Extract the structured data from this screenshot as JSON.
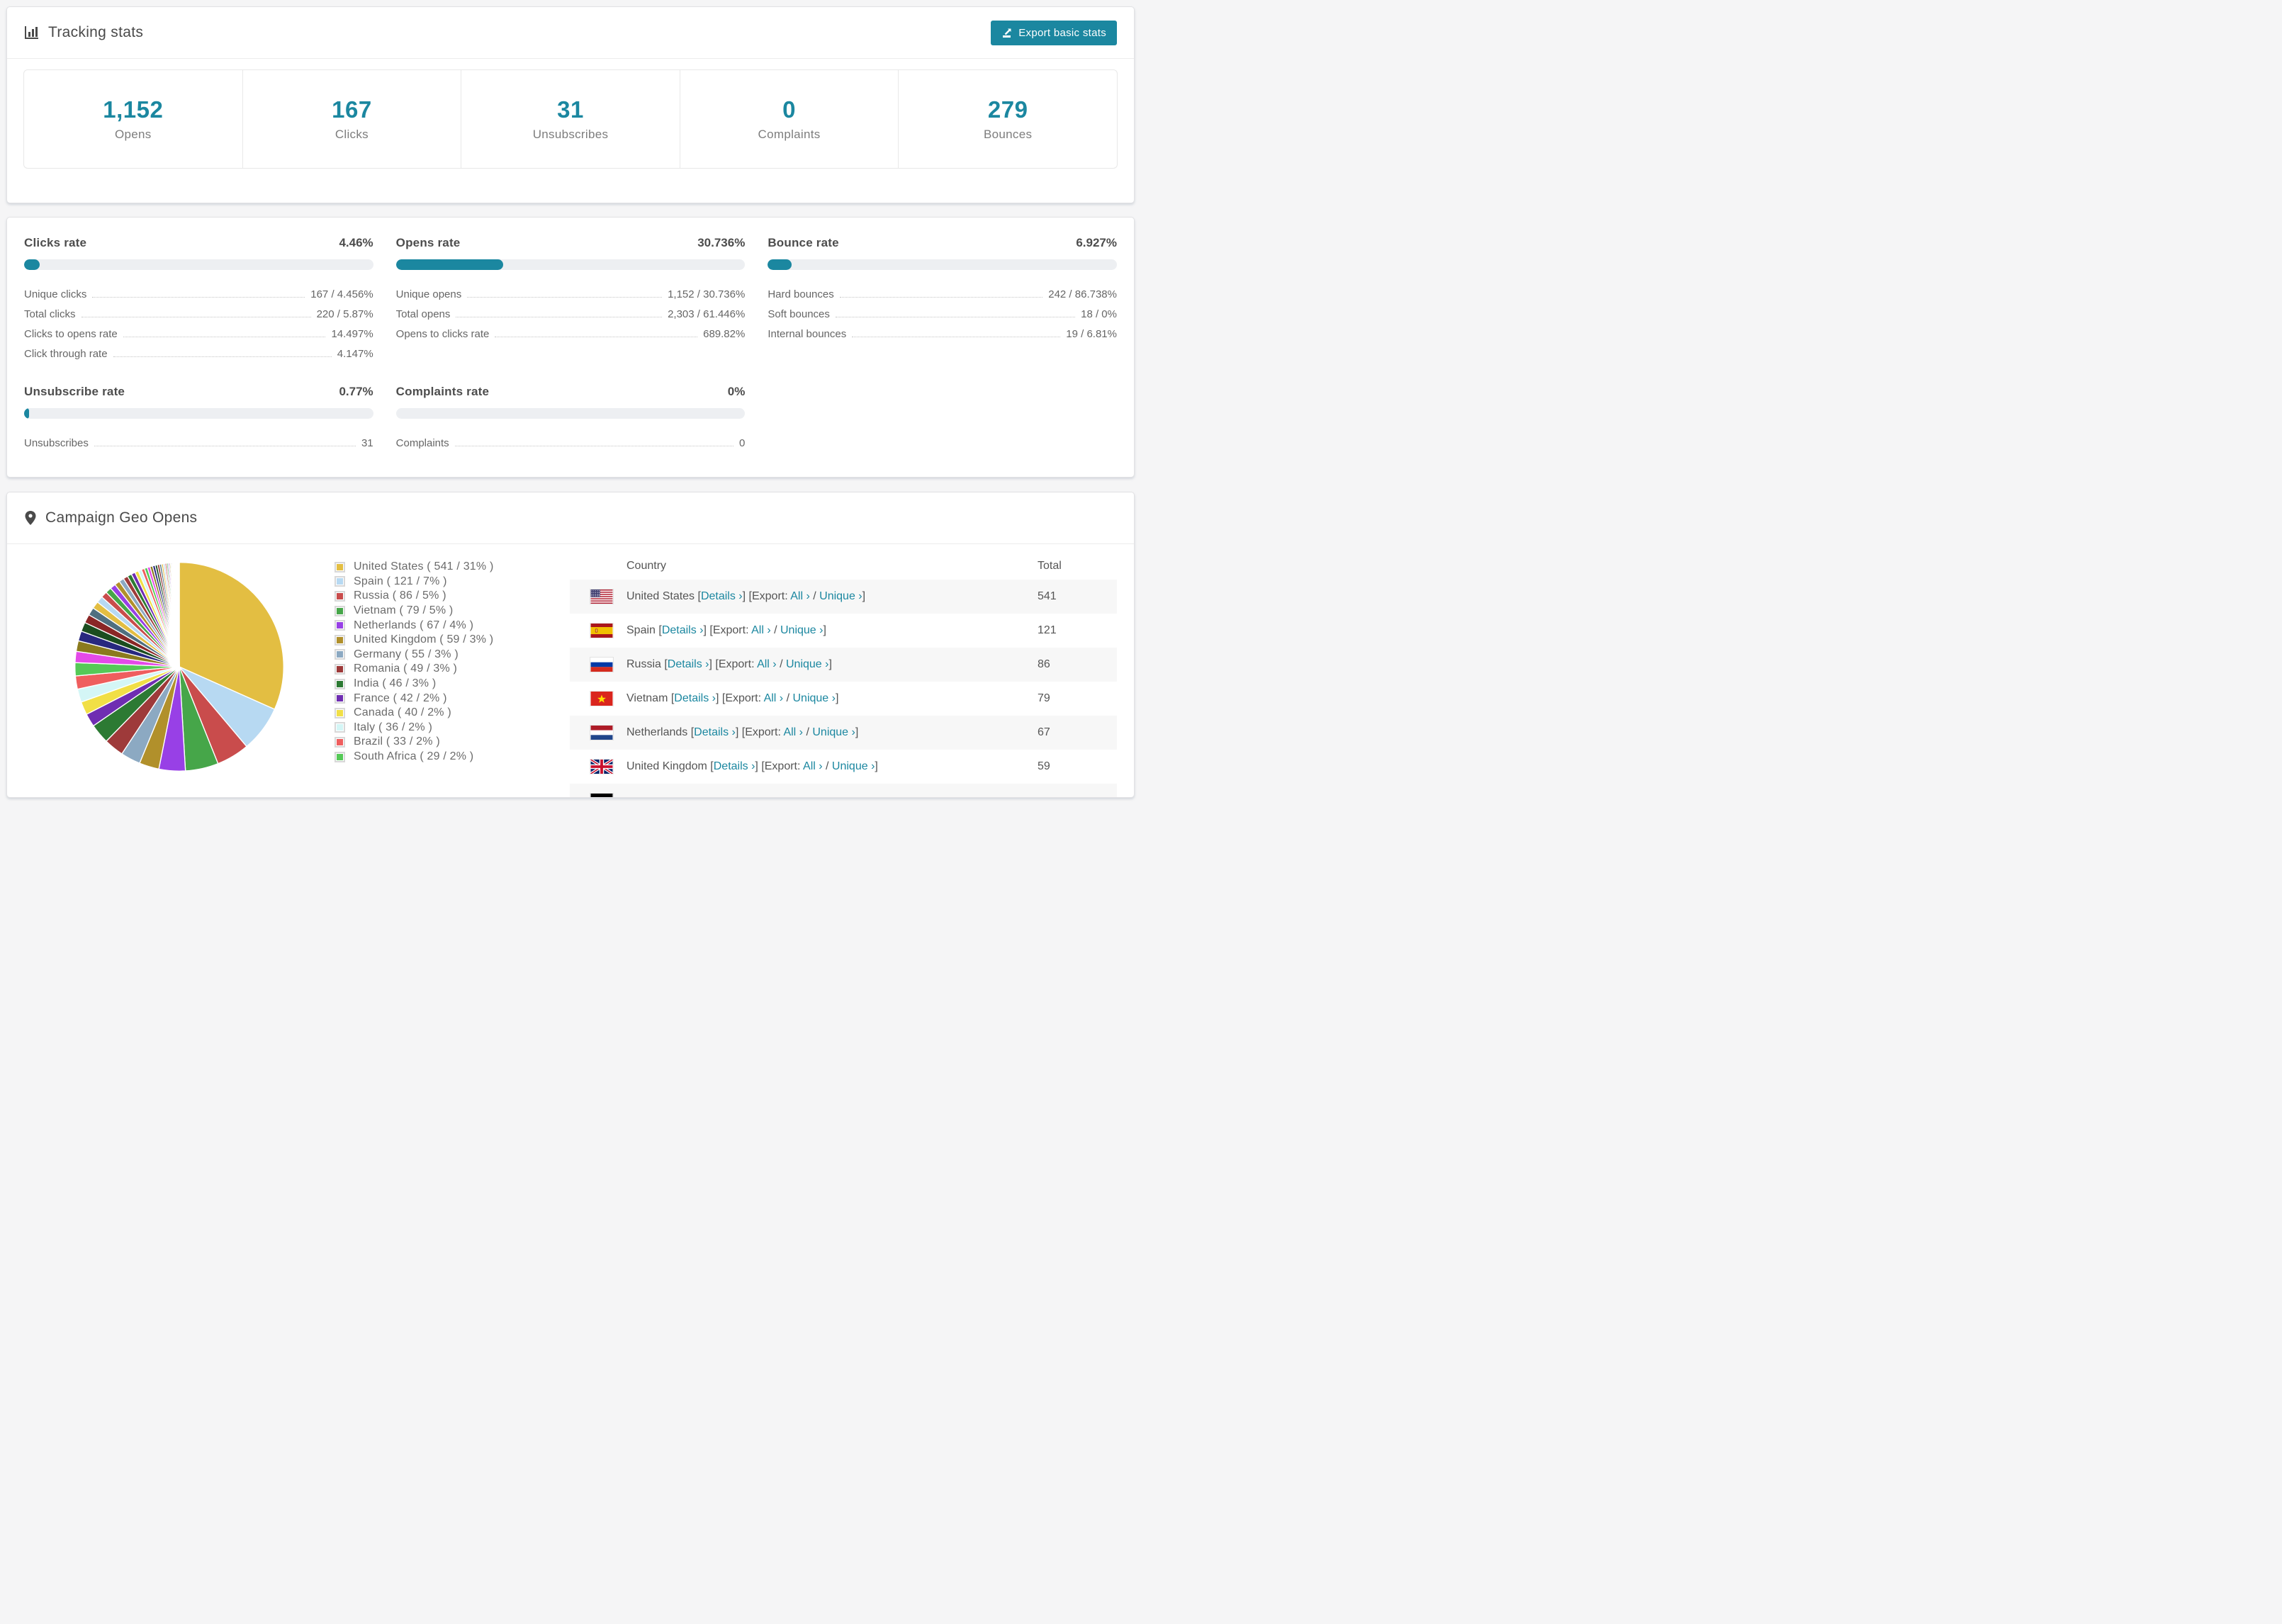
{
  "colors": {
    "accent_teal": "#1b87a0",
    "track_gray": "#edeff2",
    "stripe_gray": "#f7f7f7",
    "palette_extra": [
      "#e44ae8",
      "#8a7a1e",
      "#28287f",
      "#1b4d1f",
      "#8a2626",
      "#4f6f80"
    ]
  },
  "tracking_stats": {
    "title": "Tracking stats",
    "icon": "bar-chart-icon",
    "export_button": "Export basic stats",
    "summary": [
      {
        "value": "1,152",
        "label": "Opens"
      },
      {
        "value": "167",
        "label": "Clicks"
      },
      {
        "value": "31",
        "label": "Unsubscribes"
      },
      {
        "value": "0",
        "label": "Complaints"
      },
      {
        "value": "279",
        "label": "Bounces"
      }
    ]
  },
  "rates": [
    {
      "title": "Clicks rate",
      "value": "4.46%",
      "pct": 4.46,
      "rows": [
        {
          "label": "Unique clicks",
          "value": "167 / 4.456%"
        },
        {
          "label": "Total clicks",
          "value": "220 / 5.87%"
        },
        {
          "label": "Clicks to opens rate",
          "value": "14.497%"
        },
        {
          "label": "Click through rate",
          "value": "4.147%"
        }
      ]
    },
    {
      "title": "Opens rate",
      "value": "30.736%",
      "pct": 30.736,
      "rows": [
        {
          "label": "Unique opens",
          "value": "1,152 / 30.736%"
        },
        {
          "label": "Total opens",
          "value": "2,303 / 61.446%"
        },
        {
          "label": "Opens to clicks rate",
          "value": "689.82%"
        }
      ]
    },
    {
      "title": "Bounce rate",
      "value": "6.927%",
      "pct": 6.927,
      "rows": [
        {
          "label": "Hard bounces",
          "value": "242 / 86.738%"
        },
        {
          "label": "Soft bounces",
          "value": "18 / 0%"
        },
        {
          "label": "Internal bounces",
          "value": "19 / 6.81%"
        }
      ]
    },
    {
      "title": "Unsubscribe rate",
      "value": "0.77%",
      "pct": 0.77,
      "rows": [
        {
          "label": "Unsubscribes",
          "value": "31"
        }
      ]
    },
    {
      "title": "Complaints rate",
      "value": "0%",
      "pct": 0,
      "rows": [
        {
          "label": "Complaints",
          "value": "0"
        }
      ]
    }
  ],
  "geo": {
    "title": "Campaign Geo Opens",
    "icon": "map-marker-icon",
    "link_labels": {
      "details": "Details",
      "export": "Export:",
      "all": "All",
      "unique": "Unique",
      "chevron": "›"
    },
    "table": {
      "columns": [
        "Country",
        "Total"
      ],
      "rows": [
        {
          "flag": "us",
          "country": "United States",
          "total": "541",
          "links": true
        },
        {
          "flag": "es",
          "country": "Spain",
          "total": "121",
          "links": true
        },
        {
          "flag": "ru",
          "country": "Russia",
          "total": "86",
          "links": true
        },
        {
          "flag": "vn",
          "country": "Vietnam",
          "total": "79",
          "links": true
        },
        {
          "flag": "nl",
          "country": "Netherlands",
          "total": "67",
          "links": true
        },
        {
          "flag": "gb",
          "country": "United Kingdom",
          "total": "59",
          "links": true
        },
        {
          "flag": "de",
          "country": "",
          "total": "",
          "links": false
        }
      ]
    }
  },
  "chart_data": {
    "type": "pie",
    "title": "Campaign Geo Opens",
    "legend_position": "right",
    "series": [
      {
        "name": "United States",
        "value": 541,
        "pct": 31,
        "color": "#e3be42"
      },
      {
        "name": "Spain",
        "value": 121,
        "pct": 7,
        "color": "#b7d9f2"
      },
      {
        "name": "Russia",
        "value": 86,
        "pct": 5,
        "color": "#c94c4c"
      },
      {
        "name": "Vietnam",
        "value": 79,
        "pct": 5,
        "color": "#46a649"
      },
      {
        "name": "Netherlands",
        "value": 67,
        "pct": 4,
        "color": "#9840e6"
      },
      {
        "name": "United Kingdom",
        "value": 59,
        "pct": 3,
        "color": "#b1902b"
      },
      {
        "name": "Germany",
        "value": 55,
        "pct": 3,
        "color": "#8ca9c2"
      },
      {
        "name": "Romania",
        "value": 49,
        "pct": 3,
        "color": "#9e3a3a"
      },
      {
        "name": "India",
        "value": 46,
        "pct": 3,
        "color": "#2c7a33"
      },
      {
        "name": "France",
        "value": 42,
        "pct": 2,
        "color": "#6f2db2"
      },
      {
        "name": "Canada",
        "value": 40,
        "pct": 2,
        "color": "#f1df46"
      },
      {
        "name": "Italy",
        "value": 36,
        "pct": 2,
        "color": "#d4f6f6"
      },
      {
        "name": "Brazil",
        "value": 33,
        "pct": 2,
        "color": "#ef5e5e"
      },
      {
        "name": "South Africa",
        "value": 29,
        "pct": 2,
        "color": "#55c957"
      }
    ],
    "other_slices_pct": [
      1.7,
      1.6,
      1.5,
      1.4,
      1.3,
      1.2,
      1.1,
      1.0,
      0.95,
      0.9,
      0.85,
      0.8,
      0.75,
      0.7,
      0.65,
      0.6,
      0.55,
      0.5,
      0.48,
      0.45,
      0.42,
      0.4,
      0.38,
      0.35,
      0.32,
      0.3,
      0.28,
      0.26,
      0.24,
      0.22,
      0.2,
      0.18,
      0.16,
      0.15,
      0.14,
      0.13,
      0.12,
      0.11,
      0.1,
      0.09,
      0.08,
      0.07,
      0.06,
      0.05,
      0.05
    ]
  }
}
